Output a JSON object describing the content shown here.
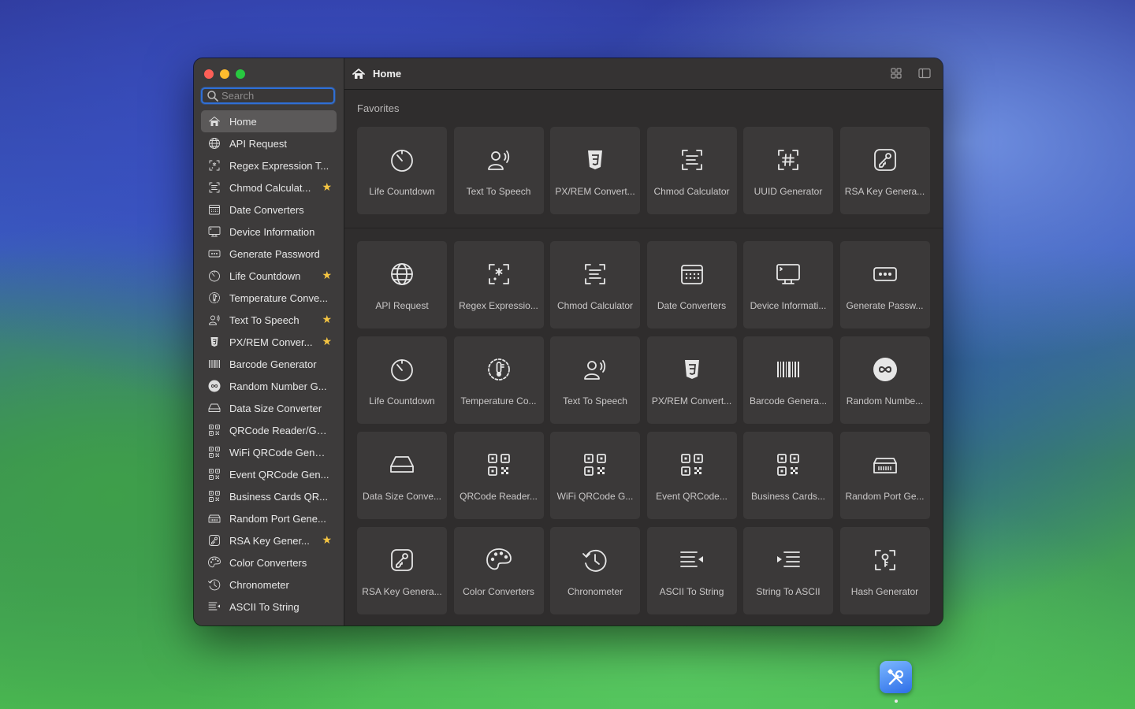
{
  "window": {
    "title": "Home"
  },
  "search": {
    "placeholder": "Search"
  },
  "sidebar": {
    "items": [
      {
        "label": "Home",
        "icon": "house-icon",
        "active": true,
        "favorite": false
      },
      {
        "label": "API Request",
        "icon": "globe-icon",
        "favorite": false
      },
      {
        "label": "Regex Expression T...",
        "icon": "regex-icon",
        "favorite": false
      },
      {
        "label": "Chmod Calculat...",
        "icon": "chmod-icon",
        "favorite": true
      },
      {
        "label": "Date Converters",
        "icon": "calendar-icon",
        "favorite": false
      },
      {
        "label": "Device Information",
        "icon": "desktop-icon",
        "favorite": false
      },
      {
        "label": "Generate Password",
        "icon": "password-icon",
        "favorite": false
      },
      {
        "label": "Life Countdown",
        "icon": "timer-icon",
        "favorite": true
      },
      {
        "label": "Temperature Conve...",
        "icon": "thermometer-icon",
        "favorite": false
      },
      {
        "label": "Text To Speech",
        "icon": "speech-icon",
        "favorite": true
      },
      {
        "label": "PX/REM Conver...",
        "icon": "css-icon",
        "favorite": true
      },
      {
        "label": "Barcode Generator",
        "icon": "barcode-icon",
        "favorite": false
      },
      {
        "label": "Random Number G...",
        "icon": "infinity-icon",
        "favorite": false
      },
      {
        "label": "Data Size Converter",
        "icon": "drive-icon",
        "favorite": false
      },
      {
        "label": "QRCode Reader/Ge...",
        "icon": "qrcode-icon",
        "favorite": false
      },
      {
        "label": "WiFi QRCode Gener...",
        "icon": "qrcode-icon",
        "favorite": false
      },
      {
        "label": "Event QRCode Gen...",
        "icon": "qrcode-icon",
        "favorite": false
      },
      {
        "label": "Business Cards QR...",
        "icon": "qrcode-icon",
        "favorite": false
      },
      {
        "label": "Random Port Gene...",
        "icon": "port-icon",
        "favorite": false
      },
      {
        "label": "RSA Key Gener...",
        "icon": "signature-icon",
        "favorite": true
      },
      {
        "label": "Color Converters",
        "icon": "palette-icon",
        "favorite": false
      },
      {
        "label": "Chronometer",
        "icon": "history-icon",
        "favorite": false
      },
      {
        "label": "ASCII To String",
        "icon": "text-left-icon",
        "favorite": false
      }
    ]
  },
  "main": {
    "favorites_title": "Favorites",
    "favorites": [
      {
        "label": "Life Countdown",
        "icon": "timer-icon"
      },
      {
        "label": "Text To Speech",
        "icon": "speech-icon"
      },
      {
        "label": "PX/REM Convert...",
        "icon": "css-icon"
      },
      {
        "label": "Chmod Calculator",
        "icon": "chmod-icon"
      },
      {
        "label": "UUID Generator",
        "icon": "hash-icon"
      },
      {
        "label": "RSA Key Genera...",
        "icon": "signature-icon"
      }
    ],
    "tools": [
      {
        "label": "API Request",
        "icon": "globe-icon"
      },
      {
        "label": "Regex Expressio...",
        "icon": "regex-icon"
      },
      {
        "label": "Chmod Calculator",
        "icon": "chmod-icon"
      },
      {
        "label": "Date Converters",
        "icon": "calendar-icon"
      },
      {
        "label": "Device Informati...",
        "icon": "desktop-icon"
      },
      {
        "label": "Generate Passw...",
        "icon": "password-icon"
      },
      {
        "label": "Life Countdown",
        "icon": "timer-icon"
      },
      {
        "label": "Temperature Co...",
        "icon": "thermometer-icon"
      },
      {
        "label": "Text To Speech",
        "icon": "speech-icon"
      },
      {
        "label": "PX/REM Convert...",
        "icon": "css-icon"
      },
      {
        "label": "Barcode Genera...",
        "icon": "barcode-icon"
      },
      {
        "label": "Random Numbe...",
        "icon": "infinity-icon"
      },
      {
        "label": "Data Size Conve...",
        "icon": "drive-icon"
      },
      {
        "label": "QRCode Reader...",
        "icon": "qrcode-icon"
      },
      {
        "label": "WiFi QRCode G...",
        "icon": "qrcode-icon"
      },
      {
        "label": "Event QRCode...",
        "icon": "qrcode-icon"
      },
      {
        "label": "Business Cards...",
        "icon": "qrcode-icon"
      },
      {
        "label": "Random Port Ge...",
        "icon": "port-icon"
      },
      {
        "label": "RSA Key Genera...",
        "icon": "signature-icon"
      },
      {
        "label": "Color Converters",
        "icon": "palette-icon"
      },
      {
        "label": "Chronometer",
        "icon": "history-icon"
      },
      {
        "label": "ASCII To String",
        "icon": "text-left-icon"
      },
      {
        "label": "String To ASCII",
        "icon": "text-right-icon"
      },
      {
        "label": "Hash Generator",
        "icon": "key-scan-icon"
      }
    ]
  },
  "colors": {
    "accent": "#2f6fd6",
    "star": "#f5c542",
    "sidebar_bg": "#3d3b3b",
    "card_bg": "#3b3939"
  }
}
